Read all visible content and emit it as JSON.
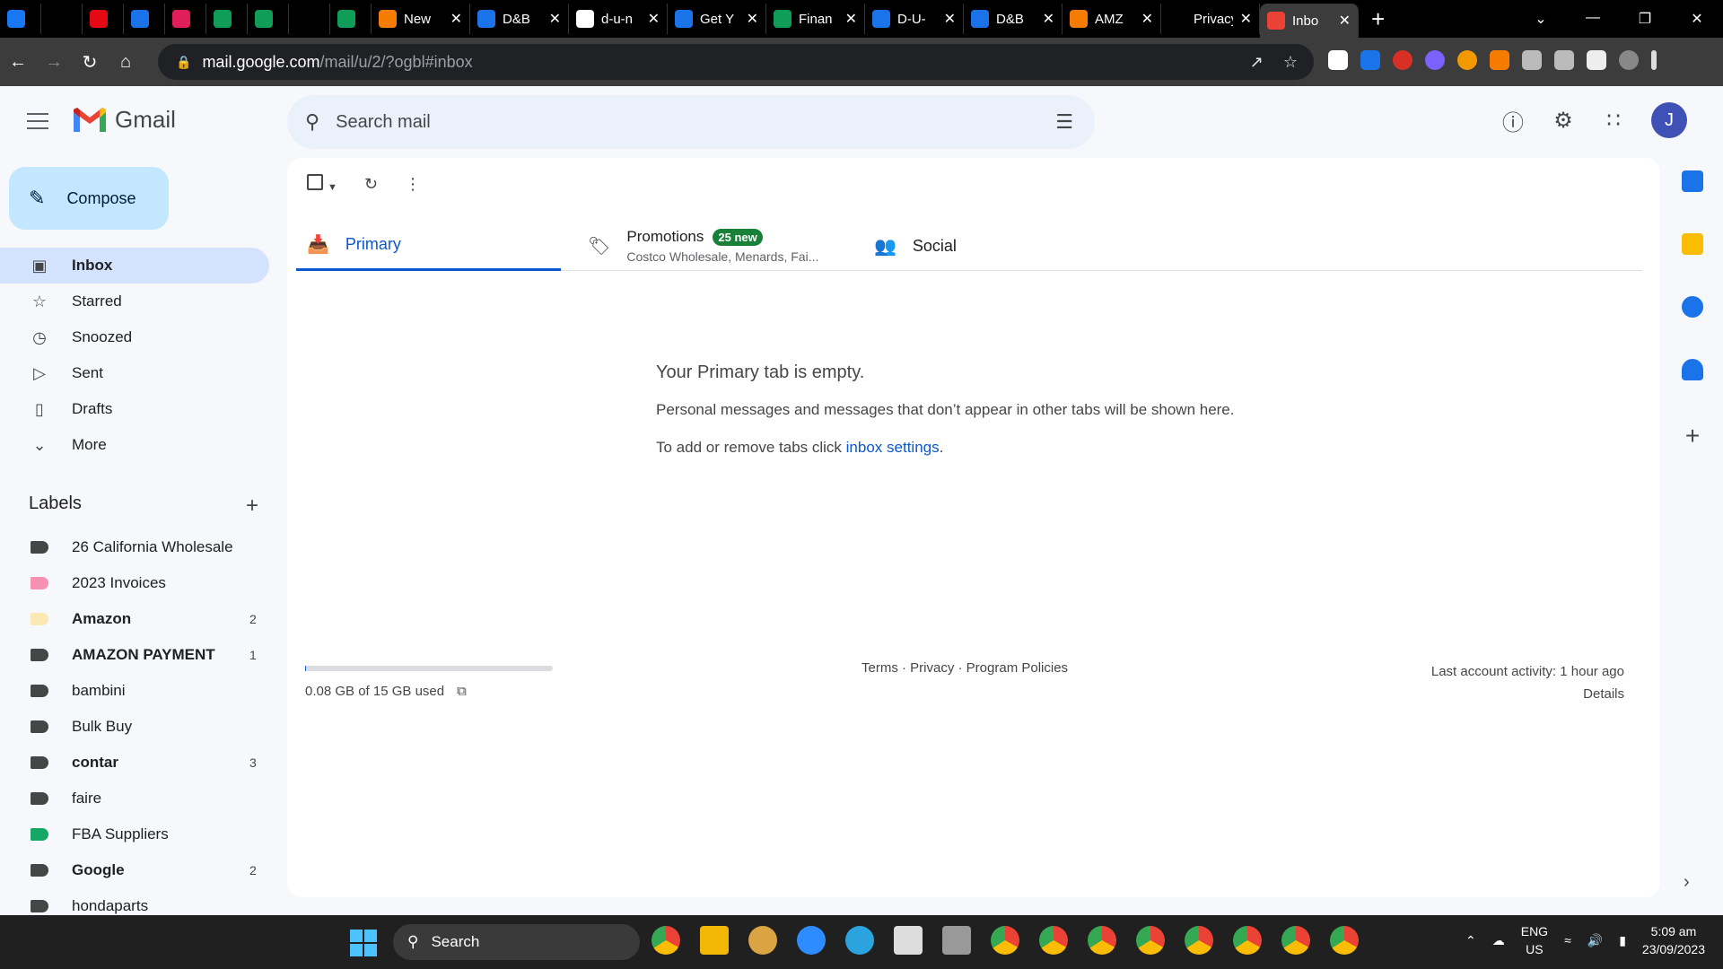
{
  "browser": {
    "tabs": [
      {
        "title": "",
        "icon": "facebook-icon",
        "color": "#1877f2"
      },
      {
        "title": "",
        "icon": "speaker-icon",
        "color": "#000000"
      },
      {
        "title": "",
        "icon": "netflix-icon",
        "color": "#e50914"
      },
      {
        "title": "",
        "icon": "play-icon",
        "color": "#1a73e8"
      },
      {
        "title": "",
        "icon": "slack-icon",
        "color": "#e01e5a"
      },
      {
        "title": "",
        "icon": "sheets-icon",
        "color": "#0f9d58"
      },
      {
        "title": "",
        "icon": "sheets-icon",
        "color": "#0f9d58"
      },
      {
        "title": "",
        "icon": "amazon-icon",
        "color": "#000000"
      },
      {
        "title": "",
        "icon": "sheets-icon",
        "color": "#0f9d58"
      },
      {
        "title": "New",
        "icon": "brand-icon",
        "color": "#f57c00"
      },
      {
        "title": "D&B",
        "icon": "dnb-icon",
        "color": "#1a73e8"
      },
      {
        "title": "d-u-n",
        "icon": "google-icon",
        "color": "#ffffff"
      },
      {
        "title": "Get Y",
        "icon": "dnb-icon",
        "color": "#1a73e8"
      },
      {
        "title": "Finan",
        "icon": "sheets-icon",
        "color": "#0f9d58"
      },
      {
        "title": "D-U-",
        "icon": "dnb-icon",
        "color": "#1a73e8"
      },
      {
        "title": "D&B",
        "icon": "dnb-icon",
        "color": "#1a73e8"
      },
      {
        "title": "AMZ",
        "icon": "brand-icon",
        "color": "#f57c00"
      },
      {
        "title": "Privacy e",
        "icon": "",
        "color": ""
      },
      {
        "title": "Inbo",
        "icon": "gmail-icon",
        "color": "#ea4335",
        "active": true
      }
    ],
    "url_host": "mail.google.com",
    "url_path": "/mail/u/2/?ogbl#inbox"
  },
  "gmail": {
    "brand": "Gmail",
    "search_placeholder": "Search mail",
    "avatar_letter": "J",
    "compose_label": "Compose",
    "nav": [
      {
        "label": "Inbox",
        "icon": "inbox-icon",
        "selected": true
      },
      {
        "label": "Starred",
        "icon": "star-icon"
      },
      {
        "label": "Snoozed",
        "icon": "clock-icon"
      },
      {
        "label": "Sent",
        "icon": "send-icon"
      },
      {
        "label": "Drafts",
        "icon": "draft-icon"
      },
      {
        "label": "More",
        "icon": "chevron-down-icon"
      }
    ],
    "labels_title": "Labels",
    "labels": [
      {
        "name": "26 California Wholesale",
        "color": "#444746",
        "count": "",
        "bold": false
      },
      {
        "name": "2023 Invoices",
        "color": "#f691b2",
        "count": "",
        "bold": false
      },
      {
        "name": "Amazon",
        "color": "#fce8b2",
        "count": "2",
        "bold": true
      },
      {
        "name": "AMAZON PAYMENT",
        "color": "#444746",
        "count": "1",
        "bold": true
      },
      {
        "name": "bambini",
        "color": "#444746",
        "count": "",
        "bold": false
      },
      {
        "name": "Bulk Buy",
        "color": "#444746",
        "count": "",
        "bold": false
      },
      {
        "name": "contar",
        "color": "#444746",
        "count": "3",
        "bold": true
      },
      {
        "name": "faire",
        "color": "#444746",
        "count": "",
        "bold": false
      },
      {
        "name": "FBA Suppliers",
        "color": "#16a765",
        "count": "",
        "bold": false
      },
      {
        "name": "Google",
        "color": "#444746",
        "count": "2",
        "bold": true
      },
      {
        "name": "hondaparts",
        "color": "#444746",
        "count": "",
        "bold": false
      }
    ],
    "inbox_tabs": {
      "primary": "Primary",
      "promotions": "Promotions",
      "promotions_badge": "25 new",
      "promotions_sub": "Costco Wholesale, Menards, Fai...",
      "social": "Social"
    },
    "empty": {
      "title": "Your Primary tab is empty.",
      "line1": "Personal messages and messages that don’t appear in other tabs will be shown here.",
      "line2_prefix": "To add or remove tabs click ",
      "line2_link": "inbox settings",
      "line2_suffix": "."
    },
    "footer": {
      "storage": "0.08 GB of 15 GB used",
      "storage_fraction": 0.005,
      "links": "Terms · Privacy · Program Policies",
      "activity": "Last account activity: 1 hour ago",
      "details": "Details"
    }
  },
  "taskbar": {
    "search_label": "Search",
    "lang1": "ENG",
    "lang2": "US",
    "time": "5:09 am",
    "date": "23/09/2023"
  }
}
